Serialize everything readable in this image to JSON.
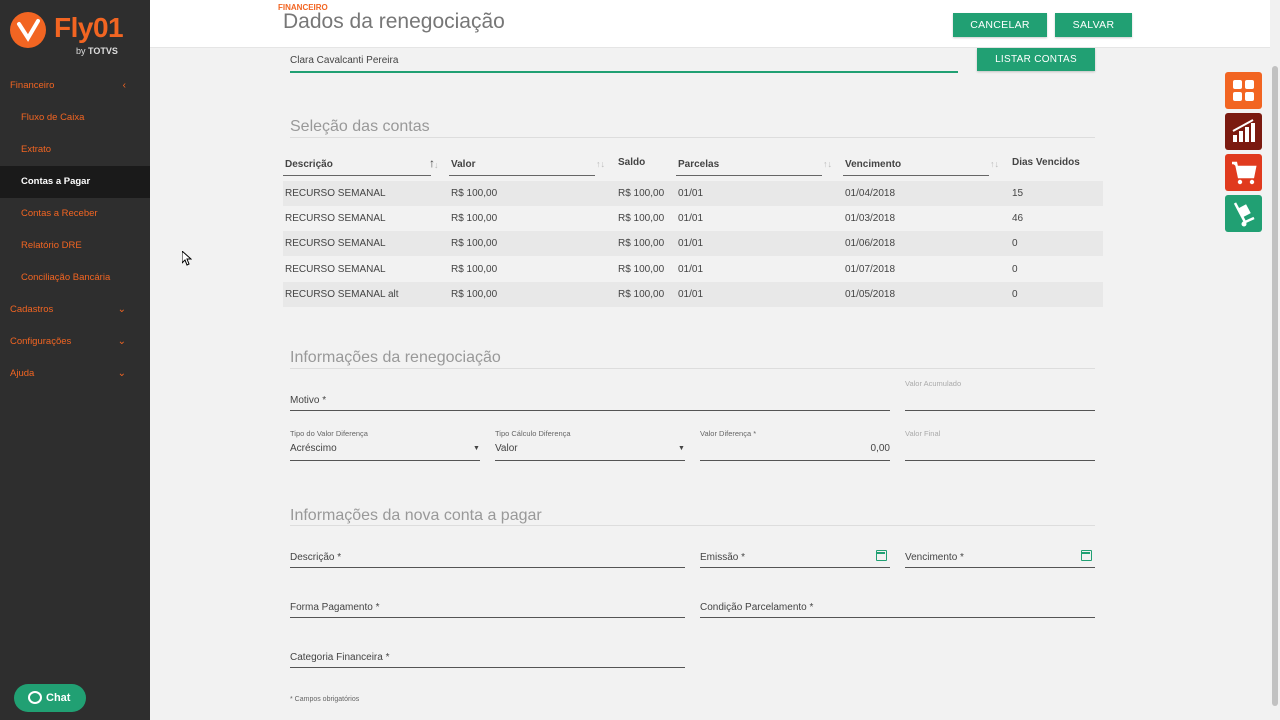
{
  "brand": {
    "name": "Fly01",
    "by": "by",
    "vendor": "TOTVS",
    "color": "#f26522"
  },
  "sidebar": {
    "items": [
      {
        "label": "Financeiro",
        "type": "group",
        "chevron": "‹"
      },
      {
        "label": "Fluxo de Caixa",
        "type": "sub"
      },
      {
        "label": "Extrato",
        "type": "sub"
      },
      {
        "label": "Contas a Pagar",
        "type": "sub",
        "active": true
      },
      {
        "label": "Contas a Receber",
        "type": "sub"
      },
      {
        "label": "Relatório DRE",
        "type": "sub"
      },
      {
        "label": "Conciliação Bancária",
        "type": "sub"
      },
      {
        "label": "Cadastros",
        "type": "group",
        "chevron": "⌄"
      },
      {
        "label": "Configurações",
        "type": "group",
        "chevron": "⌄"
      },
      {
        "label": "Ajuda",
        "type": "group",
        "chevron": "⌄"
      }
    ]
  },
  "chat": {
    "label": "Chat"
  },
  "header": {
    "breadcrumb": "FINANCEIRO",
    "title": "Dados da renegociação",
    "cancel_label": "CANCELAR",
    "save_label": "SALVAR"
  },
  "supplier": {
    "value": "Clara Cavalcanti Pereira",
    "list_button": "LISTAR CONTAS"
  },
  "selection": {
    "title": "Seleção das contas",
    "columns": [
      "Descrição",
      "Valor",
      "Saldo",
      "Parcelas",
      "Vencimento",
      "Dias Vencidos"
    ],
    "rows": [
      [
        "RECURSO SEMANAL",
        "R$ 100,00",
        "R$ 100,00",
        "01/01",
        "01/04/2018",
        "15"
      ],
      [
        "RECURSO SEMANAL",
        "R$ 100,00",
        "R$ 100,00",
        "01/01",
        "01/03/2018",
        "46"
      ],
      [
        "RECURSO SEMANAL",
        "R$ 100,00",
        "R$ 100,00",
        "01/01",
        "01/06/2018",
        "0"
      ],
      [
        "RECURSO SEMANAL",
        "R$ 100,00",
        "R$ 100,00",
        "01/01",
        "01/07/2018",
        "0"
      ],
      [
        "RECURSO SEMANAL alt",
        "R$ 100,00",
        "R$ 100,00",
        "01/01",
        "01/05/2018",
        "0"
      ]
    ]
  },
  "renegotiation": {
    "title": "Informações da renegociação",
    "motivo_label": "Motivo *",
    "valor_acumulado_label": "Valor Acumulado",
    "tipo_valor_label": "Tipo do Valor Diferença",
    "tipo_valor_value": "Acréscimo",
    "tipo_calculo_label": "Tipo Cálculo Diferença",
    "tipo_calculo_value": "Valor",
    "valor_diferenca_label": "Valor Diferença *",
    "valor_diferenca_value": "0,00",
    "valor_final_label": "Valor Final",
    "select_arrow": "▼"
  },
  "new_account": {
    "title": "Informações da nova conta a pagar",
    "descricao_label": "Descrição *",
    "emissao_label": "Emissão *",
    "vencimento_label": "Vencimento *",
    "forma_pagamento_label": "Forma Pagamento *",
    "condicao_label": "Condição Parcelamento *",
    "categoria_label": "Categoria Financeira *",
    "required_note": "* Campos obrigatórios"
  },
  "apps": [
    {
      "icon": "grid-apps-icon",
      "color": "#f26522"
    },
    {
      "icon": "bar-chart-icon",
      "color": "#7b1a10"
    },
    {
      "icon": "cart-icon",
      "color": "#e03a1e"
    },
    {
      "icon": "hand-truck-icon",
      "color": "#21a073"
    }
  ],
  "colors": {
    "accent": "#21a073",
    "sidebar": "#2e2e2e"
  }
}
